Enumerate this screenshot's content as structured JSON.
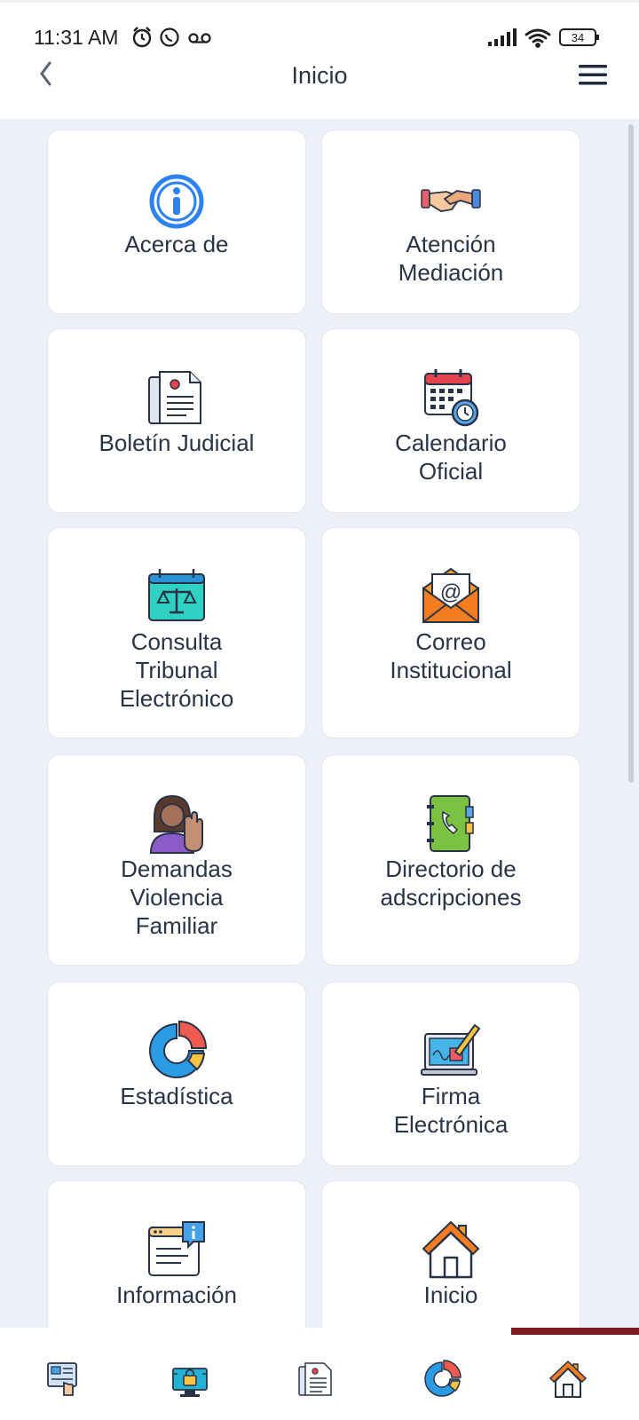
{
  "status_bar": {
    "time": "11:31 AM",
    "battery": "34"
  },
  "header": {
    "title": "Inicio"
  },
  "cards": [
    {
      "label": "Acerca de",
      "icon": "info-icon"
    },
    {
      "label": "Atención\nMediación",
      "icon": "handshake-icon"
    },
    {
      "label": "Boletín Judicial",
      "icon": "bulletin-document-icon"
    },
    {
      "label": "Calendario\nOficial",
      "icon": "calendar-clock-icon"
    },
    {
      "label": "Consulta\nTribunal\nElectrónico",
      "icon": "scales-calendar-icon"
    },
    {
      "label": "Correo\nInstitucional",
      "icon": "email-envelope-icon"
    },
    {
      "label": "Demandas\nViolencia\nFamiliar",
      "icon": "woman-stop-hand-icon"
    },
    {
      "label": "Directorio de\nadscripciones",
      "icon": "phone-book-icon"
    },
    {
      "label": "Estadística",
      "icon": "donut-chart-icon"
    },
    {
      "label": "Firma\nElectrónica",
      "icon": "laptop-signature-icon"
    },
    {
      "label": "Información",
      "icon": "info-window-icon"
    },
    {
      "label": "Inicio",
      "icon": "house-icon"
    }
  ],
  "bottom_nav": [
    {
      "icon": "touch-document-icon"
    },
    {
      "icon": "secure-monitor-icon"
    },
    {
      "icon": "bulletin-document-icon"
    },
    {
      "icon": "donut-chart-icon"
    },
    {
      "icon": "house-icon",
      "active": true
    }
  ],
  "colors": {
    "accent": "#7a1a22",
    "background": "#edf0f7",
    "text": "#2a3346"
  }
}
